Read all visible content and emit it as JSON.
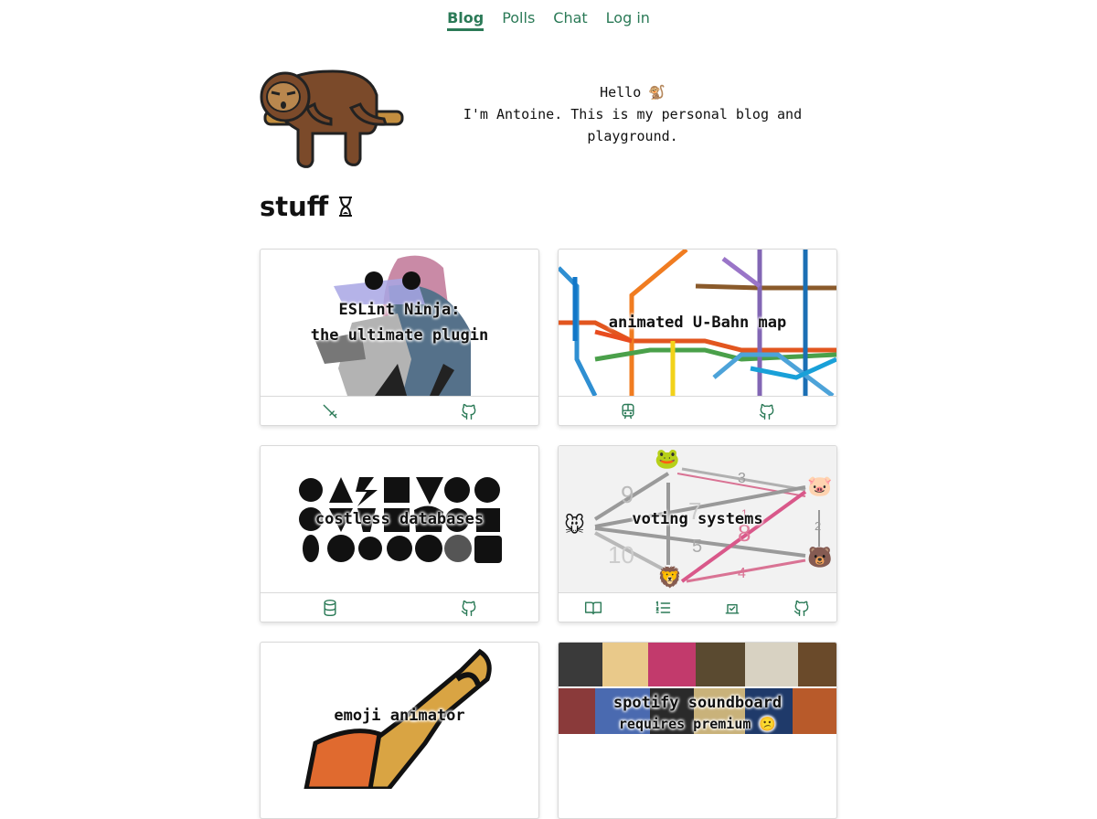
{
  "nav": {
    "items": [
      {
        "label": "Blog",
        "active": true
      },
      {
        "label": "Polls",
        "active": false
      },
      {
        "label": "Chat",
        "active": false
      },
      {
        "label": "Log in",
        "active": false
      }
    ]
  },
  "hero": {
    "greeting": "Hello",
    "greeting_emoji": "🐒",
    "intro": "I'm Antoine. This is my personal blog and playground."
  },
  "section": {
    "title": "stuff",
    "icon": "hourglass-icon"
  },
  "cards": [
    {
      "title_line1": "ESLint Ninja:",
      "title_line2": "the ultimate plugin",
      "icons": [
        "sword-icon",
        "github-icon"
      ]
    },
    {
      "title_line1": "animated U-Bahn map",
      "icons": [
        "train-icon",
        "github-icon"
      ]
    },
    {
      "title_line1": "costless databases",
      "icons": [
        "database-icon",
        "github-icon"
      ]
    },
    {
      "title_line1": "voting systems",
      "icons": [
        "book-icon",
        "list-icon",
        "ballot-icon",
        "github-icon"
      ],
      "graph_labels": [
        "9",
        "3",
        "7",
        "1",
        "8",
        "2",
        "5",
        "10",
        "4"
      ]
    },
    {
      "title_line1": "emoji animator"
    },
    {
      "title_line1": "spotify soundboard",
      "title_line2": "requires premium",
      "title_emoji": "😕"
    }
  ],
  "colors": {
    "accent": "#2b7a57",
    "text": "#111111",
    "card_border": "#d9d9d9"
  }
}
